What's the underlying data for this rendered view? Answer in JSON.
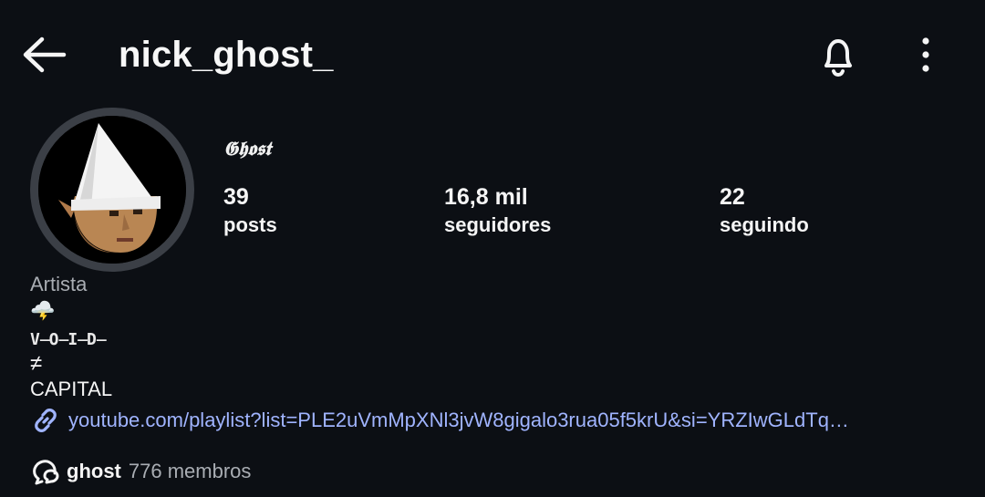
{
  "header": {
    "username": "nick_ghost_",
    "back_icon": "arrow-left-icon",
    "bell_icon": "bell-icon",
    "more_icon": "more-vertical-icon"
  },
  "profile": {
    "display_name": "𝕲𝖍𝖔𝖘𝖙",
    "avatar_icon": "gnome-avatar",
    "stats": {
      "posts": {
        "value": "39",
        "label": "posts"
      },
      "followers": {
        "value": "16,8 mil",
        "label": "seguidores"
      },
      "following": {
        "value": "22",
        "label": "seguindo"
      }
    },
    "category": "Artista",
    "bio": {
      "emoji": "🌩️",
      "void_text": "V̶O̶I̶D̶",
      "neq": "≠",
      "capital": "CAPITAL"
    },
    "link": {
      "icon": "link-icon",
      "text": "youtube.com/playlist?list=PLE2uVmMpXNl3jvW8gigalo3rua05f5krU&si=YRZIwGLdTq…"
    },
    "channel": {
      "icon": "broadcast-channel-icon",
      "name": "ghost",
      "members": "776 membros"
    }
  },
  "colors": {
    "background": "#0c0f14",
    "text": "#f5f5f5",
    "muted": "#a9adb3",
    "link": "#a0b4ff",
    "avatar_ring": "#3b3f46"
  }
}
